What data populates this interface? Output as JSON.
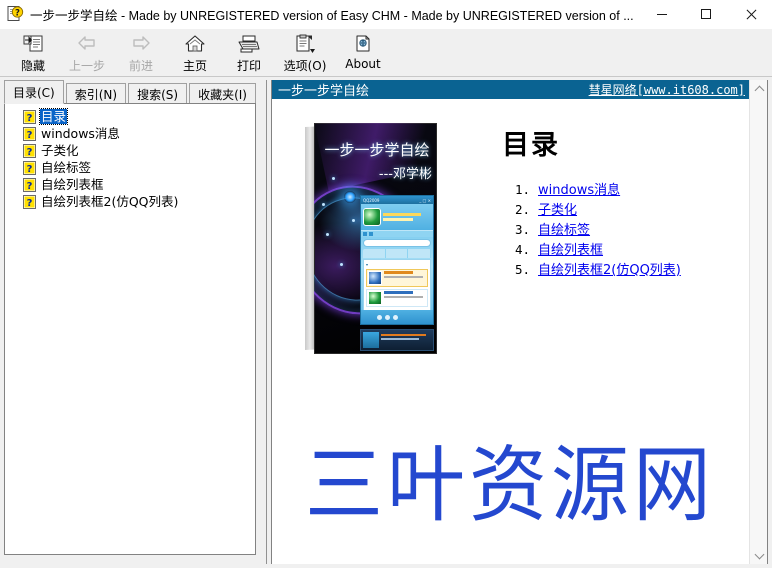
{
  "window": {
    "icon": "chm-help-icon",
    "title": "一步一步学自绘 - Made by UNREGISTERED version of Easy CHM - Made by UNREGISTERED version of ...",
    "minimize_label": "Minimize",
    "maximize_label": "Maximize",
    "close_label": "Close"
  },
  "toolbar": {
    "buttons": [
      {
        "label": "隐藏",
        "icon": "hide-pane-icon",
        "disabled": false
      },
      {
        "label": "上一步",
        "icon": "back-arrow-icon",
        "disabled": true
      },
      {
        "label": "前进",
        "icon": "forward-arrow-icon",
        "disabled": true
      },
      {
        "label": "主页",
        "icon": "home-icon",
        "disabled": false
      },
      {
        "label": "打印",
        "icon": "print-icon",
        "disabled": false
      },
      {
        "label": "选项(O)",
        "icon": "options-icon",
        "disabled": false
      },
      {
        "label": "About",
        "icon": "about-icon",
        "disabled": false
      }
    ]
  },
  "sidebar": {
    "tabs": [
      {
        "label": "目录(C)",
        "active": true
      },
      {
        "label": "索引(N)",
        "active": false
      },
      {
        "label": "搜索(S)",
        "active": false
      },
      {
        "label": "收藏夹(I)",
        "active": false
      }
    ],
    "tree": [
      {
        "label": "目录",
        "icon": "help-page-icon",
        "selected": true
      },
      {
        "label": "windows消息",
        "icon": "help-page-icon",
        "selected": false
      },
      {
        "label": "子类化",
        "icon": "help-page-icon",
        "selected": false
      },
      {
        "label": "自绘标签",
        "icon": "help-page-icon",
        "selected": false
      },
      {
        "label": "自绘列表框",
        "icon": "help-page-icon",
        "selected": false
      },
      {
        "label": "自绘列表框2(仿QQ列表)",
        "icon": "help-page-icon",
        "selected": false
      }
    ]
  },
  "content": {
    "header": {
      "title": "一步一步学自绘",
      "link": "彗星网络[www.it608.com]",
      "background_color": "#0a6392"
    },
    "cover": {
      "title": "一步一步学自绘",
      "author": "---邓学彬",
      "screenshot_caption": "QQ2009"
    },
    "heading": "目录",
    "links": [
      {
        "num": "1.",
        "label": "windows消息"
      },
      {
        "num": "2.",
        "label": "子类化"
      },
      {
        "num": "3.",
        "label": "自绘标签"
      },
      {
        "num": "4.",
        "label": "自绘列表框"
      },
      {
        "num": "5.",
        "label": "自绘列表框2(仿QQ列表)"
      }
    ],
    "link_color": "#0000ee",
    "watermark": {
      "text": "三叶资源网",
      "color": "#2448cf"
    },
    "scrollbar": {
      "up_arrow": "chevron-up-icon",
      "down_arrow": "chevron-down-icon"
    }
  }
}
